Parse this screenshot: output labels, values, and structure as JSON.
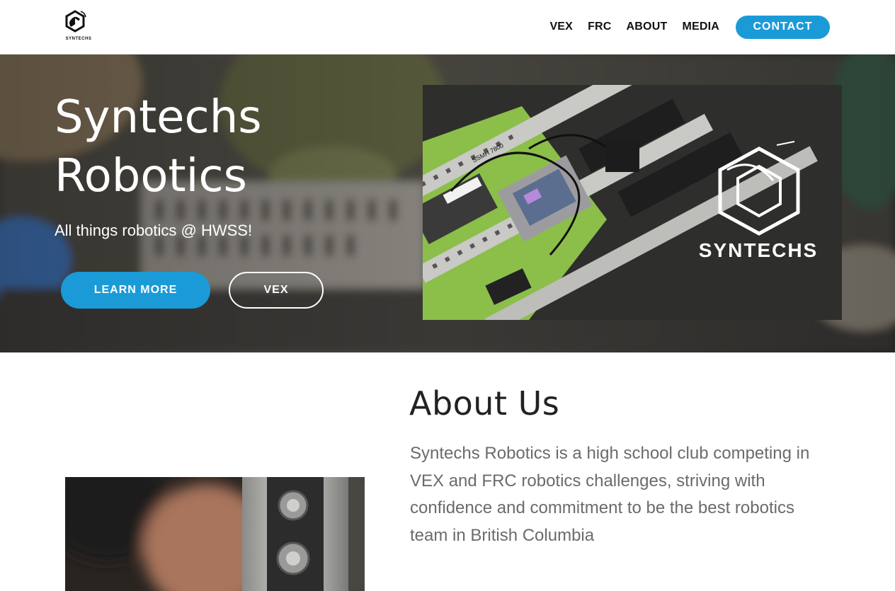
{
  "header": {
    "logo_text": "SYNTECHS",
    "nav": [
      "VEX",
      "FRC",
      "ABOUT",
      "MEDIA"
    ],
    "contact_label": "CONTACT"
  },
  "hero": {
    "title_line1": "Syntechs",
    "title_line2": "Robotics",
    "subtitle": "All things robotics @ HWSS!",
    "learn_more_label": "LEARN MORE",
    "vex_label": "VEX",
    "photo_logo_text": "SYNTECHS",
    "battery_label": "SSMH 7800"
  },
  "about": {
    "title": "About Us",
    "text": "Syntechs Robotics is a high school club competing in VEX and FRC robotics challenges, striving with confidence and commitment to be the best robotics team in British Columbia"
  },
  "colors": {
    "accent": "#1a9bd7",
    "heading": "#222222",
    "body_text": "#6b6b6b"
  }
}
